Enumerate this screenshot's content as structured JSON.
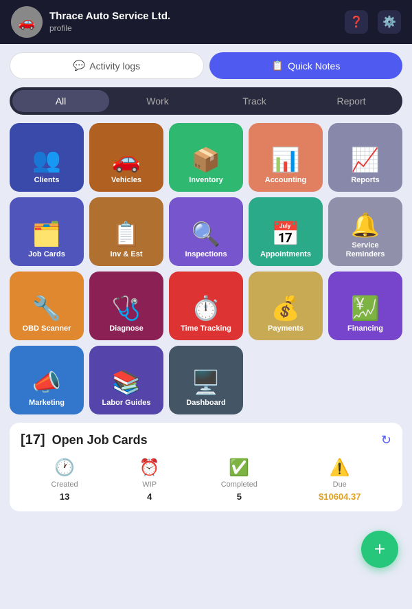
{
  "header": {
    "company": "Thrace Auto Service Ltd.",
    "subtitle": "profile",
    "avatar_emoji": "🚗",
    "help_icon": "❓",
    "settings_icon": "⚙️"
  },
  "tabs": {
    "activity_label": "Activity logs",
    "activity_icon": "💬",
    "quicknotes_label": "Quick Notes",
    "quicknotes_icon": "📋"
  },
  "filters": [
    {
      "id": "all",
      "label": "All",
      "active": true
    },
    {
      "id": "work",
      "label": "Work",
      "active": false
    },
    {
      "id": "track",
      "label": "Track",
      "active": false
    },
    {
      "id": "report",
      "label": "Report",
      "active": false
    }
  ],
  "grid_items": [
    {
      "id": "clients",
      "label": "Clients",
      "icon": "👥",
      "bg": "#3a4aaa"
    },
    {
      "id": "vehicles",
      "label": "Vehicles",
      "icon": "🚗",
      "bg": "#b06020"
    },
    {
      "id": "inventory",
      "label": "Inventory",
      "icon": "📦",
      "bg": "#2eb870"
    },
    {
      "id": "accounting",
      "label": "Accounting",
      "icon": "📊",
      "bg": "#e08060"
    },
    {
      "id": "reports",
      "label": "Reports",
      "icon": "📈",
      "bg": "#8888aa"
    },
    {
      "id": "job-cards",
      "label": "Job Cards",
      "icon": "🗂️",
      "bg": "#5055bb"
    },
    {
      "id": "inv-est",
      "label": "Inv & Est",
      "icon": "📋",
      "bg": "#b07030"
    },
    {
      "id": "inspections",
      "label": "Inspections",
      "icon": "🔍",
      "bg": "#7755cc"
    },
    {
      "id": "appointments",
      "label": "Appointments",
      "icon": "📅",
      "bg": "#2aaa88"
    },
    {
      "id": "service-reminders",
      "label": "Service Reminders",
      "icon": "🔔",
      "bg": "#9090aa"
    },
    {
      "id": "obd-scanner",
      "label": "OBD Scanner",
      "icon": "🔧",
      "bg": "#e08830"
    },
    {
      "id": "diagnose",
      "label": "Diagnose",
      "icon": "🩺",
      "bg": "#8b2055"
    },
    {
      "id": "time-tracking",
      "label": "Time Tracking",
      "icon": "⏱️",
      "bg": "#dd3333"
    },
    {
      "id": "payments",
      "label": "Payments",
      "icon": "💰",
      "bg": "#c8aa55"
    },
    {
      "id": "financing",
      "label": "Financing",
      "icon": "💹",
      "bg": "#7744cc"
    },
    {
      "id": "marketing",
      "label": "Marketing",
      "icon": "📣",
      "bg": "#3377cc"
    },
    {
      "id": "labor-guides",
      "label": "Labor Guides",
      "icon": "📚",
      "bg": "#5544aa"
    },
    {
      "id": "dashboard",
      "label": "Dashboard",
      "icon": "🖥️",
      "bg": "#445566"
    }
  ],
  "open_jobs": {
    "count": "[17]",
    "title": "Open Job Cards",
    "stats": [
      {
        "id": "created",
        "label": "Created",
        "value": "13",
        "icon": "🕐",
        "icon_color": "#888"
      },
      {
        "id": "wip",
        "label": "WIP",
        "value": "4",
        "icon": "⏰",
        "icon_color": "#888"
      },
      {
        "id": "completed",
        "label": "Completed",
        "value": "5",
        "icon": "✅",
        "icon_color": "#2eb870"
      },
      {
        "id": "due",
        "label": "Due",
        "value": "$10604.37",
        "icon": "⚠️",
        "icon_color": "#e0a020",
        "is_due": true
      }
    ]
  },
  "fab": {
    "icon": "+",
    "label": "add"
  }
}
